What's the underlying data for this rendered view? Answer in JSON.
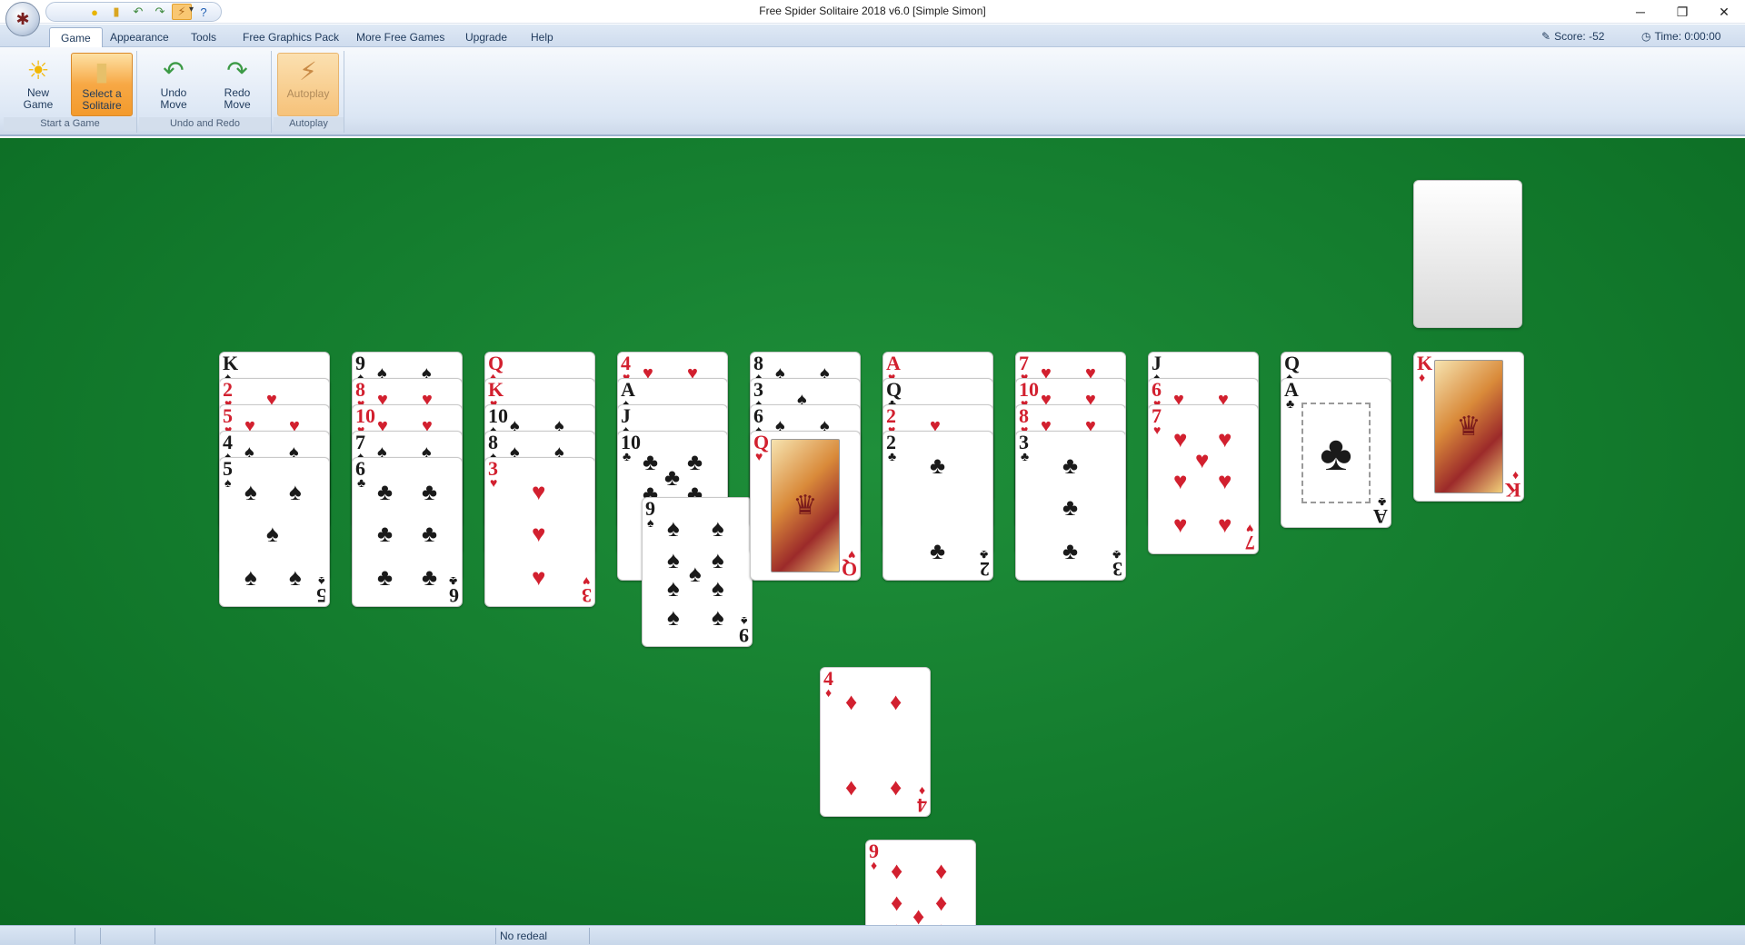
{
  "window": {
    "title": "Free Spider Solitaire 2018 v6.0  [Simple Simon]",
    "minimize": "─",
    "restore": "❐",
    "close": "✕"
  },
  "quick_access": [
    "new-game-icon",
    "select-solitaire-icon",
    "undo-icon",
    "redo-icon",
    "autoplay-icon",
    "help-icon"
  ],
  "menu": {
    "tabs": [
      "Game",
      "Appearance",
      "Tools",
      "Free Graphics Pack",
      "More Free Games",
      "Upgrade",
      "Help"
    ],
    "selected": "Game",
    "score": "Score: -52",
    "time": "Time: 0:00:00"
  },
  "ribbon": {
    "groups": [
      {
        "label": "Start a Game",
        "buttons": [
          {
            "label": "New\nGame",
            "icon": "sun-icon"
          },
          {
            "label": "Select a\nSolitaire",
            "icon": "cards-icon",
            "state": "active"
          }
        ]
      },
      {
        "label": "Undo and Redo",
        "buttons": [
          {
            "label": "Undo\nMove",
            "icon": "undo-arrow-icon"
          },
          {
            "label": "Redo\nMove",
            "icon": "redo-arrow-icon"
          }
        ]
      },
      {
        "label": "Autoplay",
        "buttons": [
          {
            "label": "Autoplay",
            "icon": "wand-icon",
            "state": "disabled"
          }
        ]
      }
    ]
  },
  "colors": {
    "felt": "#137b2d",
    "red_suit": "#d2202f",
    "black_suit": "#1a1a1a",
    "ribbon_active": "#f7a845"
  },
  "tableau": [
    [
      {
        "r": "K",
        "s": "♠"
      },
      {
        "r": "2",
        "s": "♥"
      },
      {
        "r": "5",
        "s": "♥"
      },
      {
        "r": "4",
        "s": "♠"
      },
      {
        "r": "5",
        "s": "♠"
      }
    ],
    [
      {
        "r": "9",
        "s": "♠"
      },
      {
        "r": "8",
        "s": "♥"
      },
      {
        "r": "10",
        "s": "♥"
      },
      {
        "r": "7",
        "s": "♠"
      },
      {
        "r": "6",
        "s": "♣"
      }
    ],
    [
      {
        "r": "Q",
        "s": "♦"
      },
      {
        "r": "K",
        "s": "♥"
      },
      {
        "r": "10",
        "s": "♠"
      },
      {
        "r": "8",
        "s": "♠"
      },
      {
        "r": "3",
        "s": "♥"
      }
    ],
    [
      {
        "r": "4",
        "s": "♥"
      },
      {
        "r": "A",
        "s": "♠"
      },
      {
        "r": "J",
        "s": "♠"
      },
      {
        "r": "10",
        "s": "♣"
      },
      {
        "r": "9",
        "s": "♠"
      }
    ],
    [
      {
        "r": "8",
        "s": "♠"
      },
      {
        "r": "3",
        "s": "♠"
      },
      {
        "r": "6",
        "s": "♠"
      },
      {
        "r": "Q",
        "s": "♥"
      }
    ],
    [
      {
        "r": "A",
        "s": "♥"
      },
      {
        "r": "Q",
        "s": "♣"
      },
      {
        "r": "2",
        "s": "♥"
      },
      {
        "r": "2",
        "s": "♣"
      }
    ],
    [
      {
        "r": "7",
        "s": "♥"
      },
      {
        "r": "10",
        "s": "♥"
      },
      {
        "r": "8",
        "s": "♥"
      },
      {
        "r": "3",
        "s": "♣"
      }
    ],
    [
      {
        "r": "J",
        "s": "♠"
      },
      {
        "r": "6",
        "s": "♥"
      },
      {
        "r": "7",
        "s": "♥"
      }
    ],
    [
      {
        "r": "Q",
        "s": "♠"
      },
      {
        "r": "A",
        "s": "♣"
      }
    ],
    [
      {
        "r": "K",
        "s": "♦"
      }
    ]
  ],
  "dragging": [
    {
      "r": "4",
      "s": "♦"
    },
    {
      "r": "9",
      "s": "♦"
    }
  ],
  "status": {
    "text": "No redeal"
  }
}
